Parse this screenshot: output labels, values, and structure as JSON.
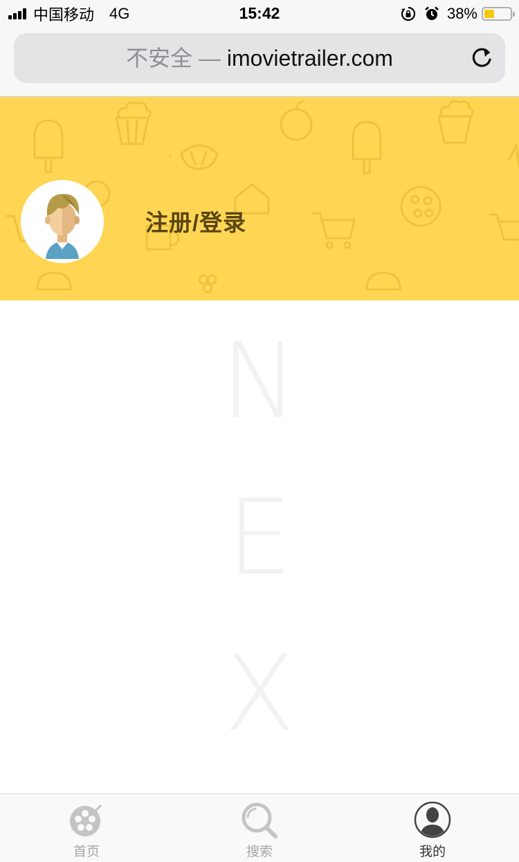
{
  "status_bar": {
    "carrier": "中国移动",
    "network": "4G",
    "time": "15:42",
    "battery_percent": "38%",
    "battery_level": 0.38,
    "icons": [
      "signal-icon",
      "orientation-lock-icon",
      "alarm-icon",
      "battery-icon"
    ]
  },
  "browser": {
    "insecure_label": "不安全 —",
    "domain": "imovietrailer.com",
    "reload_icon": "reload-icon"
  },
  "profile": {
    "login_label": "注册/登录",
    "avatar_icon": "user-avatar-icon",
    "header_color": "#fed654"
  },
  "watermark": {
    "letters": [
      "N",
      "E",
      "X"
    ]
  },
  "tab_bar": {
    "tabs": [
      {
        "label": "首页",
        "icon": "film-reel-icon",
        "active": false
      },
      {
        "label": "搜索",
        "icon": "search-icon",
        "active": false
      },
      {
        "label": "我的",
        "icon": "user-profile-icon",
        "active": true
      }
    ]
  }
}
